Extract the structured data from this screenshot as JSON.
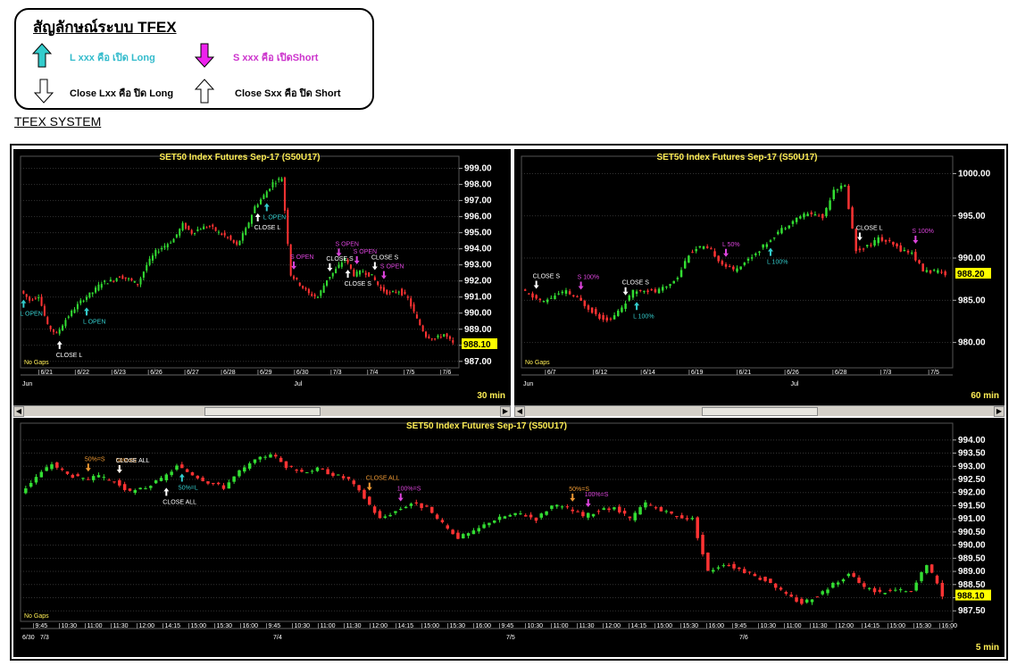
{
  "legend": {
    "title": "สัญลักษณ์ระบบ TFEX",
    "long_open": "L xxx คือ เปิด Long",
    "short_open": "S xxx คือ เปิดShort",
    "long_close": "Close Lxx คือ ปิด Long",
    "short_close": "Close Sxx คือ ปิด Short"
  },
  "system_title": "TFEX SYSTEM",
  "colors": {
    "up": "#33dd33",
    "down": "#ff3333",
    "title": "#ffee55",
    "long": "#33cccc",
    "short": "#dd44dd",
    "close": "#ffffff",
    "pct": "#ee9933",
    "last": "#ffff00"
  },
  "chart_data": [
    {
      "type": "candlestick",
      "title": "SET50  Index  Futures  Sep-17  (S50U17)",
      "timeframe": "30  min",
      "ylim": [
        986.6,
        999.2
      ],
      "yticks": [
        "999.00",
        "998.00",
        "997.00",
        "996.00",
        "995.00",
        "994.00",
        "993.00",
        "992.00",
        "991.00",
        "990.00",
        "989.00",
        "988.00",
        "987.00"
      ],
      "xticks": [
        "6/21",
        "6/22",
        "6/23",
        "6/26",
        "6/27",
        "6/28",
        "6/29",
        "6/30",
        "7/3",
        "7/4",
        "7/5",
        "7/6"
      ],
      "months": [
        "Jun",
        "Jul"
      ],
      "last_price": "988.10",
      "note": "No Gaps",
      "path": [
        991.4,
        990.8,
        991.1,
        989.2,
        988.7,
        989.6,
        990.3,
        990.9,
        991.3,
        991.9,
        992.0,
        992.3,
        992.1,
        991.8,
        993.0,
        993.8,
        994.2,
        994.6,
        995.5,
        995.0,
        995.3,
        995.4,
        995.0,
        994.7,
        994.2,
        995.2,
        996.6,
        997.3,
        998.1,
        998.4,
        992.4,
        991.8,
        991.2,
        991.0,
        992.1,
        992.7,
        993.4,
        992.4,
        992.6,
        992.3,
        991.5,
        991.2,
        991.4,
        990.9,
        989.6,
        988.6,
        988.4,
        988.7,
        988.1
      ],
      "signals": [
        {
          "text": "L OPEN",
          "kind": "long",
          "i": 0
        },
        {
          "text": "CLOSE  L",
          "kind": "close",
          "i": 4
        },
        {
          "text": "L  OPEN",
          "kind": "long",
          "i": 7
        },
        {
          "text": "CLOSE  L",
          "kind": "close",
          "i": 26
        },
        {
          "text": "L OPEN",
          "kind": "long",
          "i": 27
        },
        {
          "text": "S  OPEN",
          "kind": "short",
          "i": 30
        },
        {
          "text": "S  OPEN",
          "kind": "short",
          "i": 35
        },
        {
          "text": "S  OPEN",
          "kind": "short",
          "i": 37
        },
        {
          "text": "CLOSE  S",
          "kind": "close",
          "i": 34
        },
        {
          "text": "CLOSE  S",
          "kind": "close",
          "i": 36
        },
        {
          "text": "CLOSE  S",
          "kind": "close",
          "i": 39
        },
        {
          "text": "S  OPEN",
          "kind": "short",
          "i": 40
        }
      ]
    },
    {
      "type": "candlestick",
      "title": "SET50  Index  Futures  Sep-17  (S50U17)",
      "timeframe": "60  min",
      "ylim": [
        977.0,
        1001.0
      ],
      "yticks": [
        "1000.00",
        "995.00",
        "990.00",
        "985.00",
        "980.00"
      ],
      "xticks": [
        "6/7",
        "6/12",
        "6/14",
        "6/19",
        "6/21",
        "6/26",
        "6/28",
        "7/3",
        "7/5"
      ],
      "months": [
        "Jun",
        "Jul"
      ],
      "last_price": "988.20",
      "note": "No Gaps",
      "path": [
        986.2,
        985.4,
        984.8,
        985.6,
        986.0,
        985.2,
        984.1,
        983.0,
        982.7,
        984.2,
        986.0,
        986.3,
        986.0,
        986.6,
        987.8,
        990.5,
        991.3,
        990.9,
        989.3,
        988.6,
        989.5,
        990.6,
        991.8,
        993.1,
        994.1,
        995.0,
        995.3,
        994.8,
        998.2,
        998.5,
        990.9,
        991.4,
        992.3,
        991.8,
        991.0,
        990.6,
        988.5,
        988.4,
        988.2
      ],
      "signals": [
        {
          "text": "CLOSE  S",
          "kind": "close",
          "i": 1
        },
        {
          "text": "S  100%",
          "kind": "short",
          "i": 5
        },
        {
          "text": "CLOSE  S",
          "kind": "close",
          "i": 9
        },
        {
          "text": "L  100%",
          "kind": "long",
          "i": 10
        },
        {
          "text": "L  50%",
          "kind": "short",
          "i": 18
        },
        {
          "text": "L  100%",
          "kind": "long",
          "i": 22
        },
        {
          "text": "CLOSE  L",
          "kind": "close",
          "i": 30
        },
        {
          "text": "S  100%",
          "kind": "short",
          "i": 35
        }
      ]
    },
    {
      "type": "candlestick",
      "title": "SET50  Index  Futures  Sep-17  (S50U17)",
      "timeframe": "5  min",
      "ylim": [
        987.1,
        994.3
      ],
      "yticks": [
        "994.00",
        "993.50",
        "993.00",
        "992.50",
        "992.00",
        "991.50",
        "991.00",
        "990.50",
        "990.00",
        "989.50",
        "989.00",
        "988.50",
        "988.00",
        "987.50"
      ],
      "xticks": [
        "9:45",
        "10:30",
        "11:00",
        "11:30",
        "12:00",
        "14:15",
        "15:00",
        "15:30",
        "16:00",
        "9:45",
        "10:30",
        "11:00",
        "11:30",
        "12:00",
        "14:15",
        "15:00",
        "15:30",
        "16:00",
        "9:45",
        "10:30",
        "11:00",
        "11:30",
        "12:00",
        "14:15",
        "15:00",
        "15:30",
        "16:00",
        "9:45",
        "10:30",
        "11:00",
        "11:30",
        "12:00",
        "14:15",
        "15:00",
        "15:30",
        "16:00"
      ],
      "dates": [
        "6/30",
        "7/3",
        "7/4",
        "7/5",
        "7/6"
      ],
      "last_price": "988.10",
      "note": "No Gaps",
      "path": [
        992.0,
        992.6,
        993.1,
        992.7,
        992.5,
        992.6,
        992.4,
        992.0,
        992.2,
        992.5,
        993.0,
        992.7,
        992.4,
        992.2,
        992.8,
        993.2,
        993.5,
        993.0,
        992.8,
        992.9,
        992.7,
        992.5,
        991.8,
        991.0,
        991.3,
        991.6,
        991.4,
        990.8,
        990.3,
        990.5,
        990.9,
        991.1,
        991.2,
        991.0,
        991.5,
        991.4,
        991.1,
        991.3,
        991.4,
        991.0,
        991.6,
        991.3,
        991.1,
        991.0,
        989.0,
        989.3,
        989.1,
        988.8,
        988.6,
        988.1,
        987.8,
        988.1,
        988.5,
        988.9,
        988.4,
        988.2,
        988.3,
        988.2,
        989.3,
        988.1
      ],
      "signals": [
        {
          "text": "50%=S",
          "kind": "pct",
          "i": 4
        },
        {
          "text": "50%=S",
          "kind": "pct",
          "i": 6
        },
        {
          "text": "CLOSE  ALL",
          "kind": "close",
          "i": 6
        },
        {
          "text": "CLOSE  ALL",
          "kind": "close",
          "i": 9
        },
        {
          "text": "50%=L",
          "kind": "long",
          "i": 10
        },
        {
          "text": "CLOSE  ALL",
          "kind": "pct",
          "i": 22
        },
        {
          "text": "100%=S",
          "kind": "short",
          "i": 24
        },
        {
          "text": "100%=S",
          "kind": "short",
          "i": 36
        },
        {
          "text": "50%=S",
          "kind": "pct",
          "i": 35
        }
      ]
    }
  ]
}
